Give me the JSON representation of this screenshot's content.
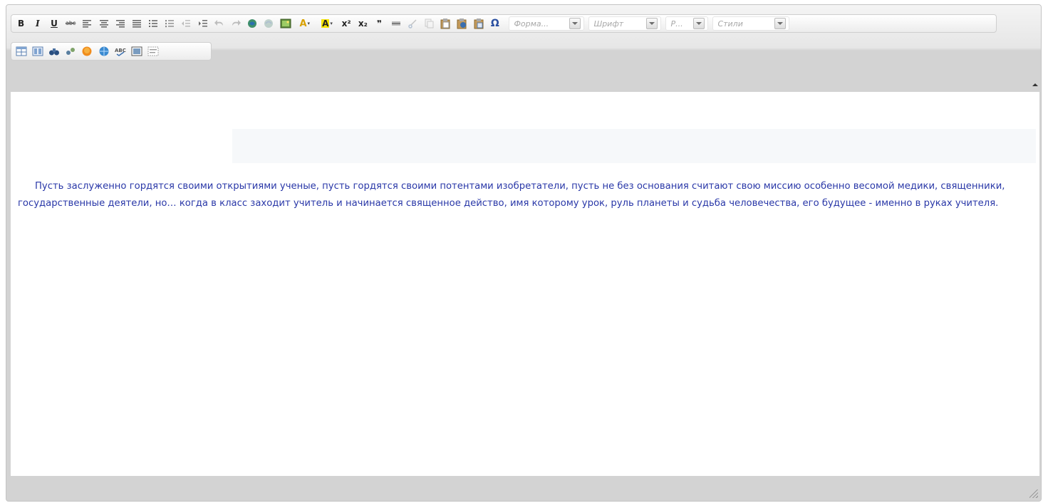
{
  "toolbar": {
    "bold": "B",
    "italic": "I",
    "underline": "U",
    "strike": "abc",
    "superscript": "x²",
    "subscript": "x₂",
    "blockquote": "❞",
    "special_char": "Ω",
    "text_color": "A",
    "bg_color": "A",
    "format_placeholder": "Форма...",
    "font_placeholder": "Шрифт",
    "size_placeholder": "Р...",
    "styles_placeholder": "Стили"
  },
  "content": {
    "paragraph": "Пусть заслуженно гордятся своими открытиями ученые, пусть гордятся своими потентами изобретатели, пусть не без основания считают свою миссию особенно весомой медики, священники, государственные деятели, но… когда в класс заходит учитель и начинается священное действо, имя которому урок, руль планеты и судьба человечества, его будущее - именно в руках учителя."
  },
  "colors": {
    "text": "#2a38a8",
    "chrome": "#d3d3d3",
    "accent_blue": "#3a6fb0"
  }
}
